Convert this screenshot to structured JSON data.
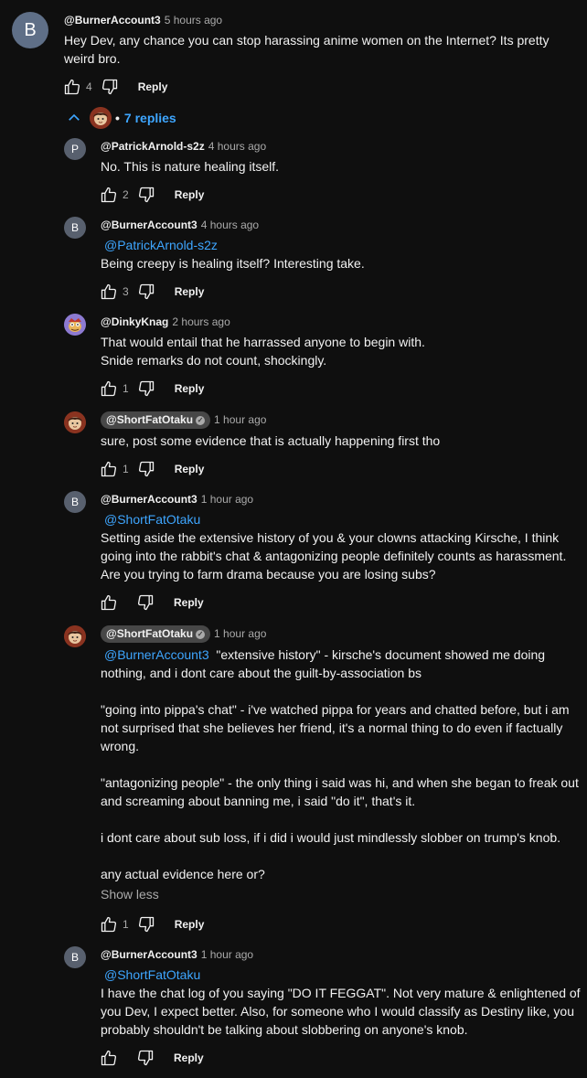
{
  "top_comment": {
    "avatar_letter": "B",
    "author": "@BurnerAccount3",
    "time": "5 hours ago",
    "text": "Hey Dev, any chance you can stop harassing anime women on the Internet? Its pretty weird bro.",
    "likes": "4",
    "reply_label": "Reply"
  },
  "replies_toggle": {
    "bullet": "•",
    "label": "7 replies"
  },
  "replies": [
    {
      "avatar_letter": "P",
      "author": "@PatrickArnold-s2z",
      "time": "4 hours ago",
      "lines": [
        "No. This is nature healing itself."
      ],
      "likes": "2",
      "reply_label": "Reply"
    },
    {
      "avatar_letter": "B",
      "author": "@BurnerAccount3",
      "time": "4 hours ago",
      "mention": "@PatrickArnold-s2z",
      "lines": [
        "Being creepy is healing itself? Interesting take."
      ],
      "likes": "3",
      "reply_label": "Reply"
    },
    {
      "author": "@DinkyKnag",
      "time": "2 hours ago",
      "lines": [
        "That would entail that he harrassed anyone to begin with.",
        "Snide remarks do not count, shockingly."
      ],
      "likes": "1",
      "reply_label": "Reply"
    },
    {
      "author": "@ShortFatOtaku",
      "verified_icon": "check-circle-icon",
      "time": "1 hour ago",
      "lines": [
        "sure, post some evidence that is actually happening first tho"
      ],
      "likes": "1",
      "reply_label": "Reply"
    },
    {
      "avatar_letter": "B",
      "author": "@BurnerAccount3",
      "time": "1 hour ago",
      "mention": "@ShortFatOtaku",
      "lines": [
        "Setting aside the extensive history of you & your clowns attacking Kirsche, I think",
        "going into the rabbit's chat & antagonizing people definitely counts as harassment.",
        "Are you trying to farm drama because you are losing subs?"
      ],
      "likes": "",
      "reply_label": "Reply"
    },
    {
      "author": "@ShortFatOtaku",
      "verified_icon": "check-circle-icon",
      "time": "1 hour ago",
      "mention": "@BurnerAccount3",
      "first_line_rest": "\"extensive history\" - kirsche's document showed me doing",
      "lines": [
        "nothing, and i dont care about the guilt-by-association bs",
        "",
        "\"going into pippa's chat\" - i've watched pippa for years and chatted before, but i am",
        "not surprised that she believes her friend, it's a normal thing to do even if factually",
        "wrong.",
        "",
        "\"antagonizing people\" - the only thing i said was hi, and when she began to freak out",
        "and screaming about banning me, i said \"do it\", that's it.",
        "",
        "i dont care about sub loss, if i did i would just mindlessly slobber on trump's knob.",
        "",
        "any actual evidence here or?"
      ],
      "show_less": "Show less",
      "likes": "1",
      "reply_label": "Reply"
    },
    {
      "avatar_letter": "B",
      "author": "@BurnerAccount3",
      "time": "1 hour ago",
      "mention": "@ShortFatOtaku",
      "lines": [
        "I have the chat log of you saying \"DO IT FEGGAT\". Not very mature & enlightened of",
        "you Dev, I expect better. Also, for someone who I would classify as Destiny like, you",
        "probably shouldn't be talking about slobbering on anyone's knob."
      ],
      "likes": "",
      "reply_label": "Reply"
    }
  ]
}
